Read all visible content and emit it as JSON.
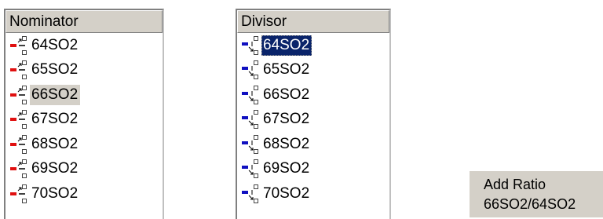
{
  "nominator": {
    "header": "Nominator",
    "icon": "red-molecule-icon",
    "color": "#e01010",
    "hover_index": 2,
    "items": [
      {
        "label": "64SO2"
      },
      {
        "label": "65SO2"
      },
      {
        "label": "66SO2"
      },
      {
        "label": "67SO2"
      },
      {
        "label": "68SO2"
      },
      {
        "label": "69SO2"
      },
      {
        "label": "70SO2"
      }
    ]
  },
  "divisor": {
    "header": "Divisor",
    "icon": "blue-molecule-icon",
    "color": "#1010c0",
    "selected_index": 0,
    "items": [
      {
        "label": "64SO2"
      },
      {
        "label": "65SO2"
      },
      {
        "label": "66SO2"
      },
      {
        "label": "67SO2"
      },
      {
        "label": "68SO2"
      },
      {
        "label": "69SO2"
      },
      {
        "label": "70SO2"
      }
    ]
  },
  "add_ratio": {
    "title": "Add Ratio",
    "ratio": "66SO2/64SO2"
  }
}
